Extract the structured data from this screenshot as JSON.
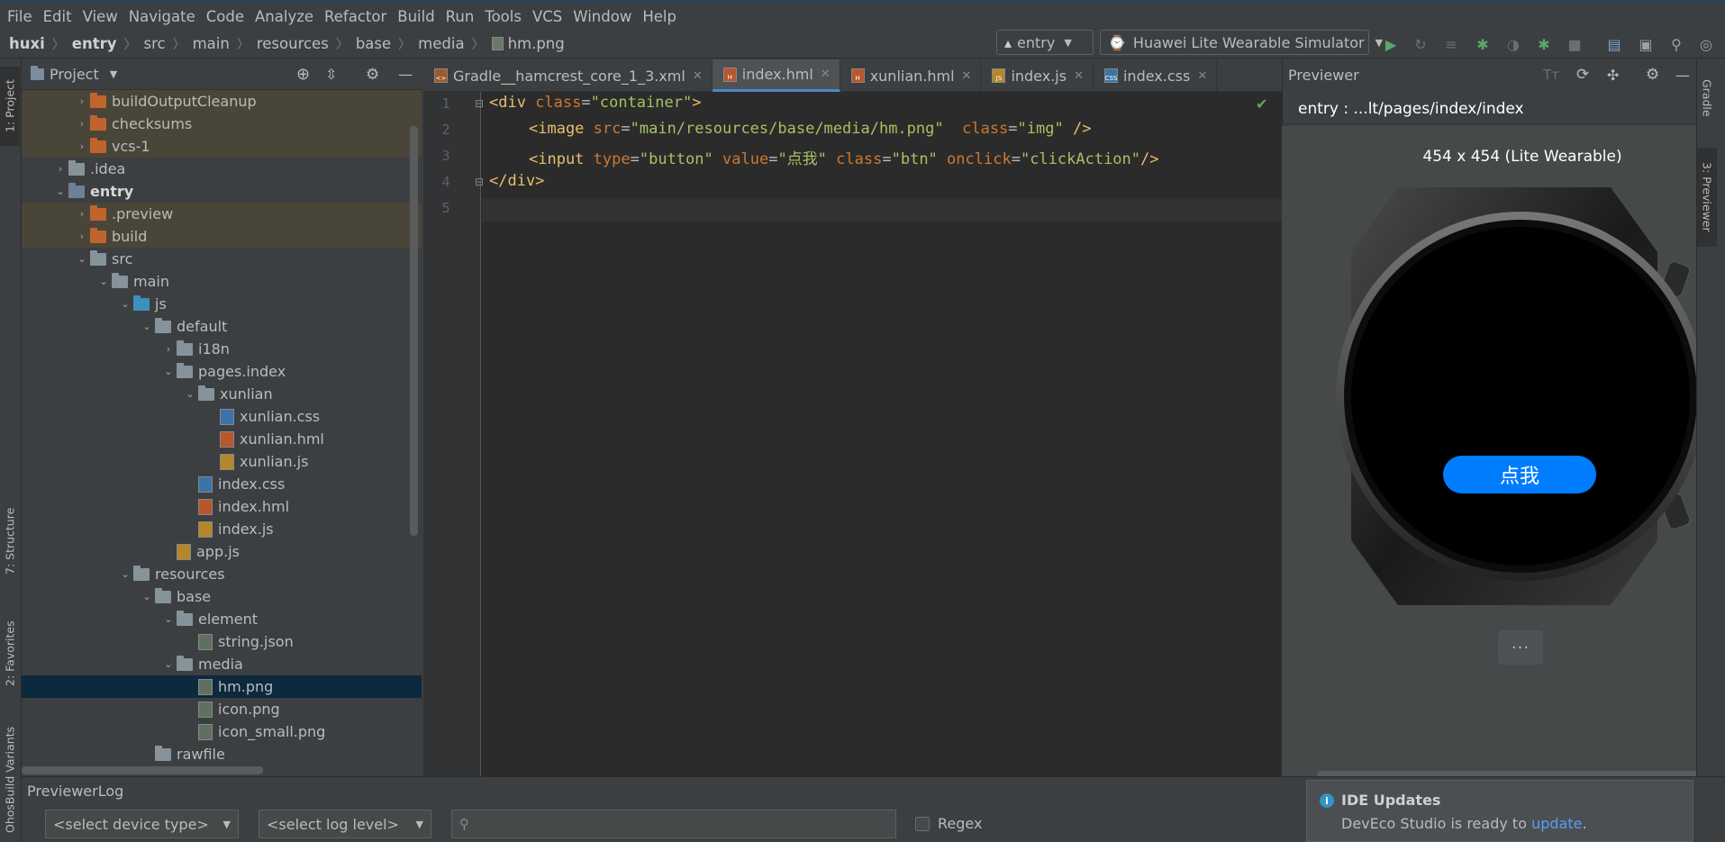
{
  "menu": [
    "File",
    "Edit",
    "View",
    "Navigate",
    "Code",
    "Analyze",
    "Refactor",
    "Build",
    "Run",
    "Tools",
    "VCS",
    "Window",
    "Help"
  ],
  "breadcrumb": [
    "huxi",
    "entry",
    "src",
    "main",
    "resources",
    "base",
    "media",
    "hm.png"
  ],
  "toolbar": {
    "config": "entry",
    "device": "Huawei Lite Wearable Simulator"
  },
  "left_tabs": [
    "1: Project",
    "7: Structure",
    "2: Favorites",
    "OhosBuild Variants"
  ],
  "project": {
    "title": "Project",
    "items": [
      {
        "label": "buildOutputCleanup",
        "arrow": "›"
      },
      {
        "label": "checksums",
        "arrow": "›"
      },
      {
        "label": "vcs-1",
        "arrow": "›"
      },
      {
        "label": ".idea",
        "arrow": "›"
      },
      {
        "label": "entry",
        "arrow": "⌄"
      },
      {
        "label": ".preview",
        "arrow": "›"
      },
      {
        "label": "build",
        "arrow": "›"
      },
      {
        "label": "src",
        "arrow": "⌄"
      },
      {
        "label": "main",
        "arrow": "⌄"
      },
      {
        "label": "js",
        "arrow": "⌄"
      },
      {
        "label": "default",
        "arrow": "⌄"
      },
      {
        "label": "i18n",
        "arrow": "›"
      },
      {
        "label": "pages.index",
        "arrow": "⌄"
      },
      {
        "label": "xunlian",
        "arrow": "⌄"
      },
      {
        "label": "xunlian.css"
      },
      {
        "label": "xunlian.hml"
      },
      {
        "label": "xunlian.js"
      },
      {
        "label": "index.css"
      },
      {
        "label": "index.hml"
      },
      {
        "label": "index.js"
      },
      {
        "label": "app.js"
      },
      {
        "label": "resources",
        "arrow": "⌄"
      },
      {
        "label": "base",
        "arrow": "⌄"
      },
      {
        "label": "element",
        "arrow": "⌄"
      },
      {
        "label": "string.json"
      },
      {
        "label": "media",
        "arrow": "⌄"
      },
      {
        "label": "hm.png"
      },
      {
        "label": "icon.png"
      },
      {
        "label": "icon_small.png"
      },
      {
        "label": "rawfile"
      }
    ]
  },
  "tabs": [
    {
      "label": "Gradle__hamcrest_core_1_3.xml",
      "badge": "<>"
    },
    {
      "label": "index.hml",
      "badge": "H"
    },
    {
      "label": "xunlian.hml",
      "badge": "H"
    },
    {
      "label": "index.js",
      "badge": "JS"
    },
    {
      "label": "index.css",
      "badge": "CSS"
    }
  ],
  "code": {
    "line_numbers": [
      "1",
      "2",
      "3",
      "4",
      "5"
    ],
    "l1": {
      "open": "<div ",
      "a1": "class",
      "eq": "=",
      "v1": "\"container\"",
      "close": ">"
    },
    "l2": {
      "open": "<image ",
      "a1": "src",
      "eq": "=",
      "v1": "\"main/resources/base/media/hm.png\"",
      "a2": "class",
      "v2": "\"img\"",
      "close": " />"
    },
    "l3": {
      "open": "<input ",
      "a1": "type",
      "eq": "=",
      "v1": "\"button\"",
      "a2": "value",
      "v2": "\"点我\"",
      "a3": "class",
      "v3": "\"btn\"",
      "a4": "onclick",
      "v4": "\"clickAction\"",
      "close": "/>"
    },
    "l4": {
      "close": "</div>"
    }
  },
  "previewer": {
    "title": "Previewer",
    "path": "entry : ...lt/pages/index/index",
    "device_label": "454 x 454 (Lite Wearable)",
    "button": "点我",
    "more": "···"
  },
  "right_tabs": [
    "Gradle",
    "3: Previewer"
  ],
  "log": {
    "title": "PreviewerLog",
    "device_select": "<select device type>",
    "level_select": "<select log level>",
    "search_placeholder": "",
    "regex": "Regex"
  },
  "notification": {
    "title": "IDE Updates",
    "text": "DevEco Studio is ready to ",
    "link": "update",
    "tail": "."
  },
  "colors": {
    "accent": "#007dff",
    "selection": "#0d293e",
    "highlight": "#4a4539",
    "run": "#59a869"
  }
}
